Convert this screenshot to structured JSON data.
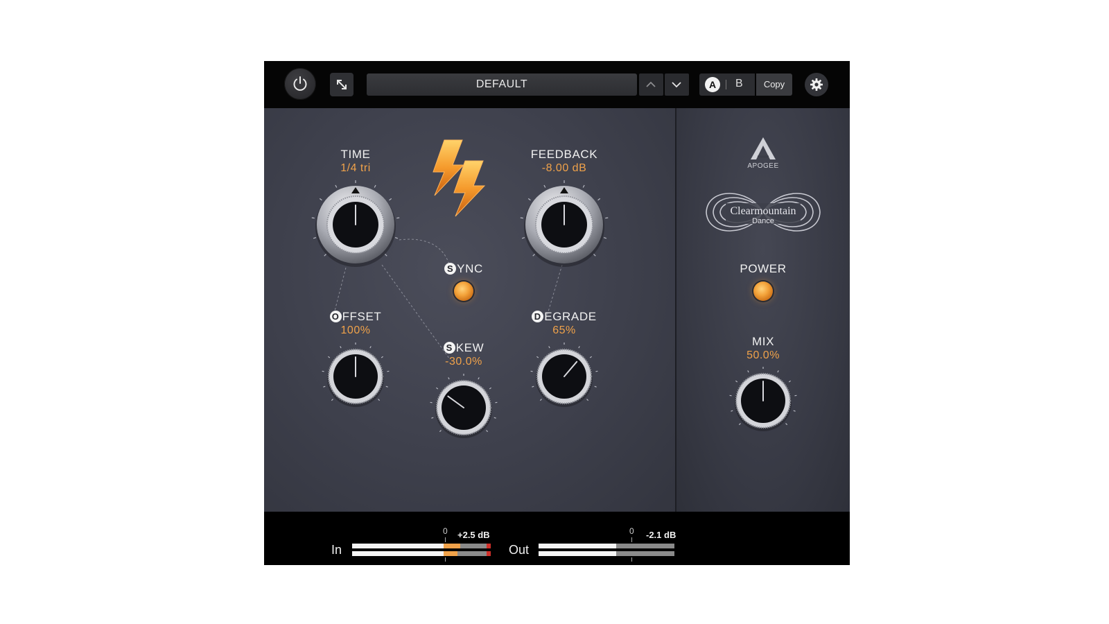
{
  "toolbar": {
    "power_icon": "power-icon",
    "resize_icon": "resize-diagonal-icon",
    "preset_name": "DEFAULT",
    "prev_icon": "chevron-up-icon",
    "next_icon": "chevron-down-icon",
    "ab_a_label": "A",
    "ab_b_label": "B",
    "copy_label": "Copy",
    "settings_icon": "gear-icon"
  },
  "controls": {
    "time": {
      "label": "TIME",
      "value": "1/4 tri",
      "level": 0.5
    },
    "feedback": {
      "label": "FEEDBACK",
      "value": "-8.00 dB",
      "level": 0.5
    },
    "sync": {
      "badge": "S",
      "label": "YNC",
      "state": "on"
    },
    "offset": {
      "badge": "O",
      "label": "FFSET",
      "value": "100%",
      "level": 0.5
    },
    "skew": {
      "badge": "S",
      "label": "KEW",
      "value": "-30.0%",
      "level": 0.3
    },
    "degrade": {
      "badge": "D",
      "label": "EGRADE",
      "value": "65%",
      "level": 0.65
    }
  },
  "side": {
    "brand_logo": "APOGEE",
    "product_logo_line1": "Clearmountain",
    "product_logo_line2": "Dance",
    "power_label": "POWER",
    "power_state": "on",
    "mix": {
      "label": "MIX",
      "value": "50.0%",
      "level": 0.5
    }
  },
  "meters": {
    "in": {
      "label": "In",
      "zero": "0",
      "peak": "+2.5 dB",
      "level_l": 0.78,
      "level_r": 0.76,
      "clip": true
    },
    "out": {
      "label": "Out",
      "zero": "0",
      "peak": "-2.1 dB",
      "level_l": 0.57,
      "level_r": 0.57,
      "clip": false
    }
  },
  "colors": {
    "accent": "#f0a24a",
    "panel": "#3e404c",
    "clip": "#d0302a"
  }
}
